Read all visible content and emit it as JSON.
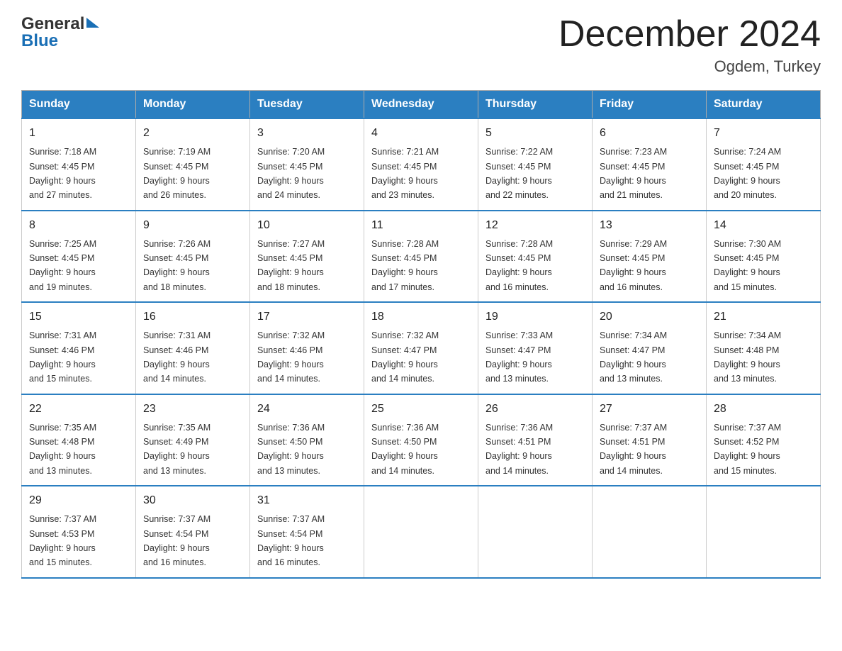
{
  "header": {
    "logo_general": "General",
    "logo_blue": "Blue",
    "title": "December 2024",
    "subtitle": "Ogdem, Turkey"
  },
  "days_of_week": [
    "Sunday",
    "Monday",
    "Tuesday",
    "Wednesday",
    "Thursday",
    "Friday",
    "Saturday"
  ],
  "weeks": [
    [
      {
        "day": "1",
        "sunrise": "7:18 AM",
        "sunset": "4:45 PM",
        "daylight": "9 hours and 27 minutes."
      },
      {
        "day": "2",
        "sunrise": "7:19 AM",
        "sunset": "4:45 PM",
        "daylight": "9 hours and 26 minutes."
      },
      {
        "day": "3",
        "sunrise": "7:20 AM",
        "sunset": "4:45 PM",
        "daylight": "9 hours and 24 minutes."
      },
      {
        "day": "4",
        "sunrise": "7:21 AM",
        "sunset": "4:45 PM",
        "daylight": "9 hours and 23 minutes."
      },
      {
        "day": "5",
        "sunrise": "7:22 AM",
        "sunset": "4:45 PM",
        "daylight": "9 hours and 22 minutes."
      },
      {
        "day": "6",
        "sunrise": "7:23 AM",
        "sunset": "4:45 PM",
        "daylight": "9 hours and 21 minutes."
      },
      {
        "day": "7",
        "sunrise": "7:24 AM",
        "sunset": "4:45 PM",
        "daylight": "9 hours and 20 minutes."
      }
    ],
    [
      {
        "day": "8",
        "sunrise": "7:25 AM",
        "sunset": "4:45 PM",
        "daylight": "9 hours and 19 minutes."
      },
      {
        "day": "9",
        "sunrise": "7:26 AM",
        "sunset": "4:45 PM",
        "daylight": "9 hours and 18 minutes."
      },
      {
        "day": "10",
        "sunrise": "7:27 AM",
        "sunset": "4:45 PM",
        "daylight": "9 hours and 18 minutes."
      },
      {
        "day": "11",
        "sunrise": "7:28 AM",
        "sunset": "4:45 PM",
        "daylight": "9 hours and 17 minutes."
      },
      {
        "day": "12",
        "sunrise": "7:28 AM",
        "sunset": "4:45 PM",
        "daylight": "9 hours and 16 minutes."
      },
      {
        "day": "13",
        "sunrise": "7:29 AM",
        "sunset": "4:45 PM",
        "daylight": "9 hours and 16 minutes."
      },
      {
        "day": "14",
        "sunrise": "7:30 AM",
        "sunset": "4:45 PM",
        "daylight": "9 hours and 15 minutes."
      }
    ],
    [
      {
        "day": "15",
        "sunrise": "7:31 AM",
        "sunset": "4:46 PM",
        "daylight": "9 hours and 15 minutes."
      },
      {
        "day": "16",
        "sunrise": "7:31 AM",
        "sunset": "4:46 PM",
        "daylight": "9 hours and 14 minutes."
      },
      {
        "day": "17",
        "sunrise": "7:32 AM",
        "sunset": "4:46 PM",
        "daylight": "9 hours and 14 minutes."
      },
      {
        "day": "18",
        "sunrise": "7:32 AM",
        "sunset": "4:47 PM",
        "daylight": "9 hours and 14 minutes."
      },
      {
        "day": "19",
        "sunrise": "7:33 AM",
        "sunset": "4:47 PM",
        "daylight": "9 hours and 13 minutes."
      },
      {
        "day": "20",
        "sunrise": "7:34 AM",
        "sunset": "4:47 PM",
        "daylight": "9 hours and 13 minutes."
      },
      {
        "day": "21",
        "sunrise": "7:34 AM",
        "sunset": "4:48 PM",
        "daylight": "9 hours and 13 minutes."
      }
    ],
    [
      {
        "day": "22",
        "sunrise": "7:35 AM",
        "sunset": "4:48 PM",
        "daylight": "9 hours and 13 minutes."
      },
      {
        "day": "23",
        "sunrise": "7:35 AM",
        "sunset": "4:49 PM",
        "daylight": "9 hours and 13 minutes."
      },
      {
        "day": "24",
        "sunrise": "7:36 AM",
        "sunset": "4:50 PM",
        "daylight": "9 hours and 13 minutes."
      },
      {
        "day": "25",
        "sunrise": "7:36 AM",
        "sunset": "4:50 PM",
        "daylight": "9 hours and 14 minutes."
      },
      {
        "day": "26",
        "sunrise": "7:36 AM",
        "sunset": "4:51 PM",
        "daylight": "9 hours and 14 minutes."
      },
      {
        "day": "27",
        "sunrise": "7:37 AM",
        "sunset": "4:51 PM",
        "daylight": "9 hours and 14 minutes."
      },
      {
        "day": "28",
        "sunrise": "7:37 AM",
        "sunset": "4:52 PM",
        "daylight": "9 hours and 15 minutes."
      }
    ],
    [
      {
        "day": "29",
        "sunrise": "7:37 AM",
        "sunset": "4:53 PM",
        "daylight": "9 hours and 15 minutes."
      },
      {
        "day": "30",
        "sunrise": "7:37 AM",
        "sunset": "4:54 PM",
        "daylight": "9 hours and 16 minutes."
      },
      {
        "day": "31",
        "sunrise": "7:37 AM",
        "sunset": "4:54 PM",
        "daylight": "9 hours and 16 minutes."
      },
      null,
      null,
      null,
      null
    ]
  ],
  "labels": {
    "sunrise": "Sunrise:",
    "sunset": "Sunset:",
    "daylight": "Daylight:"
  }
}
